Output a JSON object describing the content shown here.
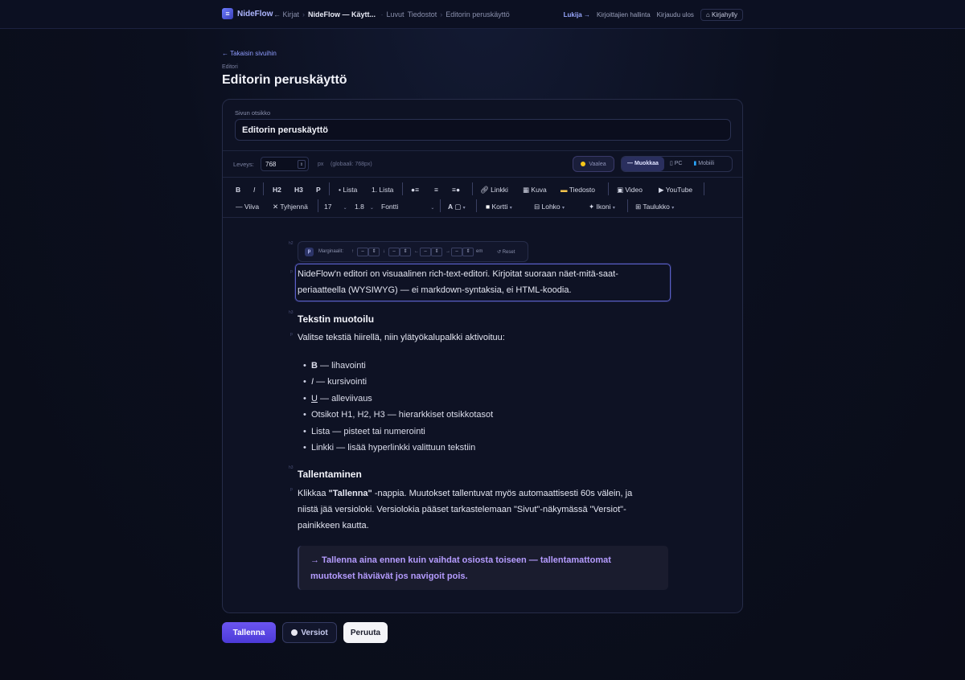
{
  "brand": {
    "name": "NideFlow"
  },
  "breadcrumb": {
    "books": "← Kirjat",
    "current_book": "NideFlow — Käytt...",
    "chapters": "Luvut",
    "files": "Tiedostot",
    "page": "Editorin peruskäyttö"
  },
  "topnav": {
    "reader": "Lukija →",
    "authors": "Kirjoittajien hallinta",
    "logout": "Kirjaudu ulos",
    "shelf": "Kirjahylly"
  },
  "back_link": "← Takaisin sivuihin",
  "section_label": "Editori",
  "page_title": "Editorin peruskäyttö",
  "form": {
    "title_label": "Sivun otsikko",
    "title_value": "Editorin peruskäyttö",
    "width_label": "Leveys:",
    "width_value": "768",
    "width_unit": "px",
    "width_global": "(globaali: 768px)",
    "theme_label": "Vaalea",
    "modes": [
      "Muokkaa",
      "PC",
      "Mobiili"
    ]
  },
  "toolbar": {
    "bold": "B",
    "italic": "I",
    "h2": "H2",
    "h3": "H3",
    "p": "P",
    "bullet_list": "• Lista",
    "numbered_list": "1. Lista",
    "link": "Linkki",
    "image": "Kuva",
    "file": "Tiedosto",
    "video": "Video",
    "youtube": "YouTube",
    "line": "— Viiva",
    "clear": "✕ Tyhjennä",
    "font_size": "17",
    "line_height": "1.8",
    "font": "Fontti",
    "color": "A",
    "card": "Kortti",
    "block": "Lohko",
    "icon": "Ikoni",
    "table": "Taulukko"
  },
  "blockbar": {
    "tag": "p",
    "margins_label": "Marginaalit:",
    "unit": "em",
    "reset": "↺ Reset"
  },
  "content": {
    "intro_line1": "NideFlow'n editori on visuaalinen rich-text-editori. Kirjoitat suoraan näet-mitä-saat-",
    "intro_line2": "periaatteella (WYSIWYG) — ei markdown-syntaksia, ei HTML-koodia.",
    "heading1": "Tekstin muotoilu",
    "para1": "Valitse tekstiä hiirellä, niin ylätyökalupalkki aktivoituu:",
    "list": [
      {
        "key": "B",
        "rest": " — lihavointi"
      },
      {
        "key": "I",
        "rest": " — kursivointi"
      },
      {
        "key": "U",
        "rest": " — alleviivaus"
      },
      {
        "key": "",
        "rest": "Otsikot H1, H2, H3 — hierarkkiset otsikkotasot"
      },
      {
        "key": "",
        "rest": "Lista — pisteet tai numerointi"
      },
      {
        "key": "",
        "rest": "Linkki — lisää hyperlinkki valittuun tekstiin"
      }
    ],
    "heading2": "Tallentaminen",
    "para2_a": "Klikkaa ",
    "para2_bold": "\"Tallenna\"",
    "para2_b": " -nappia. Muutokset tallentuvat myös automaattisesti 60s välein, ja",
    "para2_line2": "niistä jää versioloki. Versiolokia pääset tarkastelemaan \"Sivut\"-näkymässä \"Versiot\"-",
    "para2_line3": "painikkeen kautta.",
    "callout_line1": "→ Tallenna aina ennen kuin vaihdat osiosta toiseen — tallentamattomat",
    "callout_line2": "muutokset häviävät jos navigoit pois."
  },
  "actions": {
    "save": "Tallenna",
    "versions": "Versiot",
    "cancel": "Peruuta"
  },
  "colors": {
    "accent": "#5b47e6",
    "link": "#8f9cff",
    "callout_text": "#b59cff"
  }
}
